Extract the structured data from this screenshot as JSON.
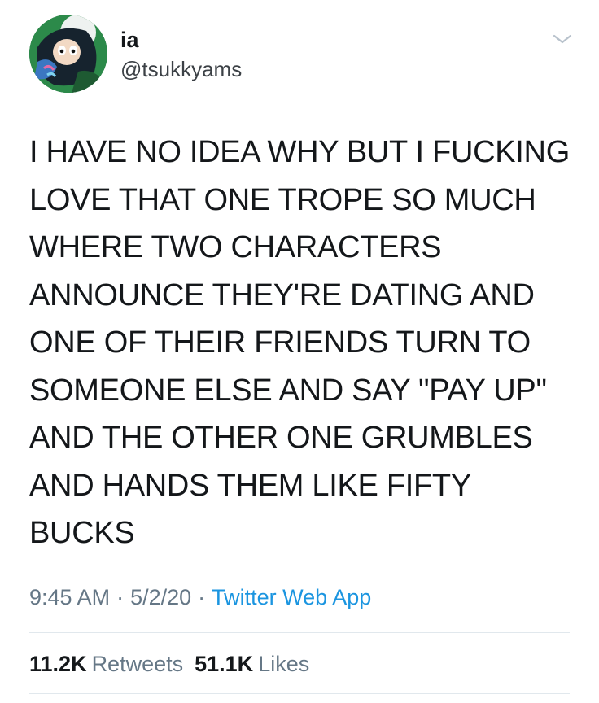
{
  "user": {
    "display_name": "ia",
    "handle": "@tsukkyams"
  },
  "tweet": {
    "text": "I HAVE NO IDEA WHY BUT I FUCKING\nLOVE THAT ONE TROPE SO MUCH\nWHERE TWO CHARACTERS\nANNOUNCE THEY'RE DATING AND\nONE OF THEIR FRIENDS TURN TO\nSOMEONE ELSE AND SAY \"PAY UP\"\nAND THE OTHER ONE GRUMBLES\nAND HANDS THEM LIKE FIFTY\nBUCKS",
    "time": "9:45 AM",
    "date": "5/2/20",
    "source": "Twitter Web App",
    "separator": "·"
  },
  "stats": {
    "retweets_count": "11.2K",
    "retweets_label": "Retweets",
    "likes_count": "51.1K",
    "likes_label": "Likes"
  },
  "colors": {
    "text": "#14171a",
    "secondary": "#657786",
    "link": "#1b95e0",
    "divider": "#e1e8ed"
  },
  "icons": {
    "menu": "chevron-down-icon"
  }
}
